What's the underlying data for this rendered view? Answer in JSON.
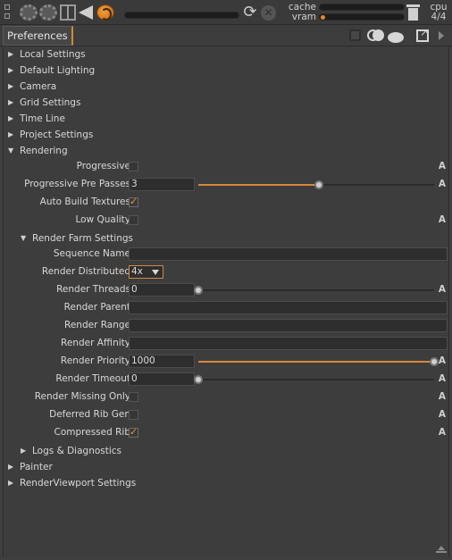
{
  "toolbar": {
    "cache_label": "cache",
    "vram_label": "vram",
    "cpu_label": "cpu",
    "cpu_value": "4/4",
    "vram_usage_fraction": 0.02,
    "cache_usage_fraction": 0.0,
    "progress_fraction": 0.0,
    "accent_color": "#e08a2a",
    "icons": [
      "grip-icon",
      "gear-icon",
      "gear-icon",
      "layout-icon",
      "back-arrow-icon",
      "globe-icon",
      "refresh-icon",
      "stop-icon",
      "trash-icon"
    ]
  },
  "panel": {
    "tab_label": "Preferences",
    "header_icons": [
      "lock-icon",
      "circles-icon",
      "ellipse-icon",
      "popout-icon",
      "expand-arrow-icon"
    ]
  },
  "sections": {
    "local_settings": "Local Settings",
    "default_lighting": "Default Lighting",
    "camera": "Camera",
    "grid_settings": "Grid Settings",
    "time_line": "Time Line",
    "project_settings": "Project Settings",
    "rendering": "Rendering",
    "render_farm_settings": "Render Farm Settings",
    "logs_diagnostics": "Logs & Diagnostics",
    "painter": "Painter",
    "renderviewport_settings": "RenderViewport Settings"
  },
  "rendering": {
    "progressive": {
      "label": "Progressive",
      "checked": false
    },
    "progressive_pre_passes": {
      "label": "Progressive Pre Passes",
      "value": "3",
      "slider_fraction": 0.51
    },
    "auto_build_textures": {
      "label": "Auto Build Textures",
      "checked": true
    },
    "low_quality": {
      "label": "Low Quality",
      "checked": false
    }
  },
  "render_farm": {
    "sequence_name": {
      "label": "Sequence Name",
      "value": ""
    },
    "render_distributed": {
      "label": "Render Distributed",
      "value": "4x"
    },
    "render_threads": {
      "label": "Render Threads",
      "value": "0",
      "slider_fraction": 0.0
    },
    "render_parent": {
      "label": "Render Parent",
      "value": ""
    },
    "render_range": {
      "label": "Render Range",
      "value": ""
    },
    "render_affinity": {
      "label": "Render Affinity",
      "value": ""
    },
    "render_priority": {
      "label": "Render Priority",
      "value": "1000",
      "slider_fraction": 1.0
    },
    "render_timeout": {
      "label": "Render Timeout",
      "value": "0",
      "slider_fraction": 0.0
    },
    "render_missing_only": {
      "label": "Render Missing Only",
      "checked": false
    },
    "deferred_rib_gen": {
      "label": "Deferred Rib Gen",
      "checked": false
    },
    "compressed_rib": {
      "label": "Compressed Rib",
      "checked": true
    }
  },
  "animate_button_label": "A"
}
